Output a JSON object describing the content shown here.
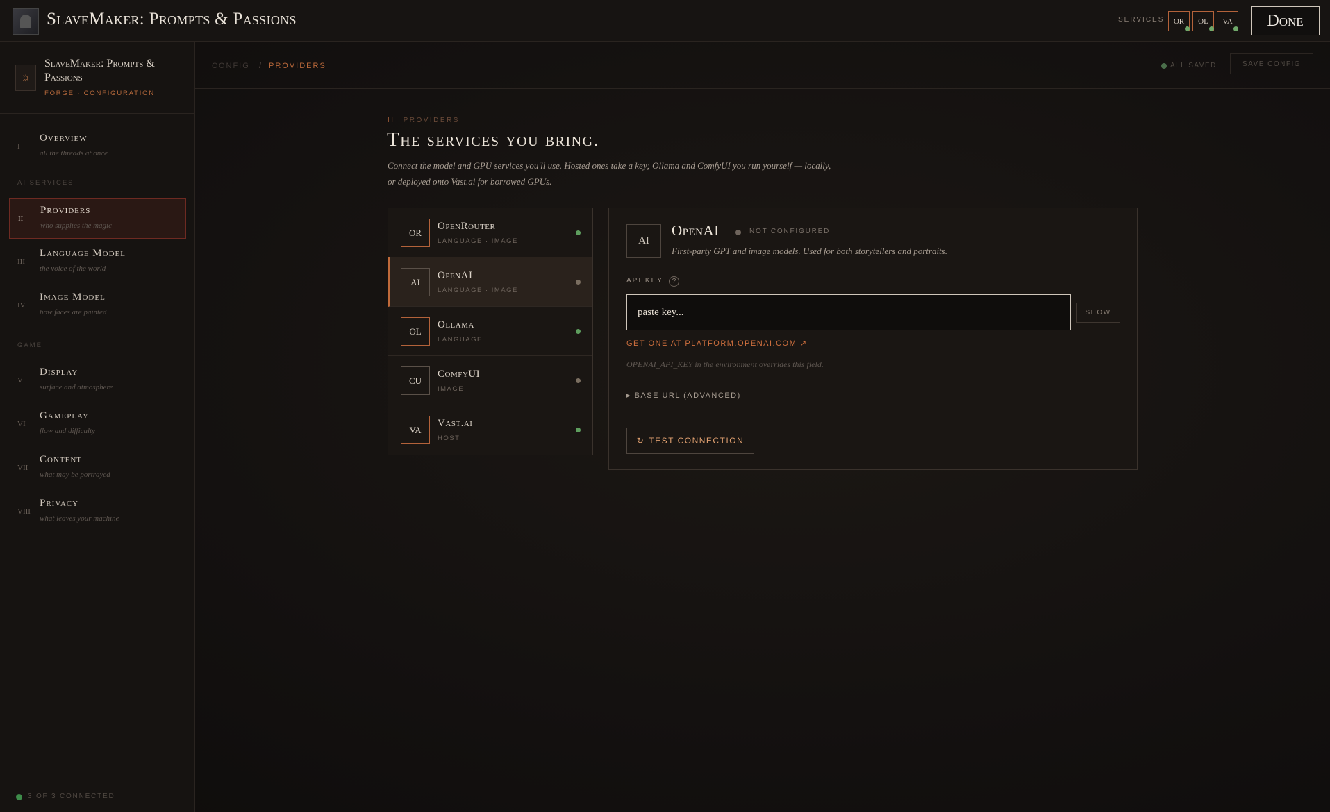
{
  "topbar": {
    "title": "SlaveMaker: Prompts & Passions",
    "services_label": "SERVICES",
    "service_chips": [
      "OR",
      "OL",
      "VA"
    ],
    "done_label": "Done"
  },
  "sidebar": {
    "title": "SlaveMaker: Prompts & Passions",
    "subtitle": "FORGE · CONFIGURATION",
    "sections": {
      "ai": "AI SERVICES",
      "game": "GAME"
    },
    "items": [
      {
        "num": "I",
        "label": "Overview",
        "desc": "all the threads at once"
      },
      {
        "num": "II",
        "label": "Providers",
        "desc": "who supplies the magic"
      },
      {
        "num": "III",
        "label": "Language Model",
        "desc": "the voice of the world"
      },
      {
        "num": "IV",
        "label": "Image Model",
        "desc": "how faces are painted"
      },
      {
        "num": "V",
        "label": "Display",
        "desc": "surface and atmosphere"
      },
      {
        "num": "VI",
        "label": "Gameplay",
        "desc": "flow and difficulty"
      },
      {
        "num": "VII",
        "label": "Content",
        "desc": "what may be portrayed"
      },
      {
        "num": "VIII",
        "label": "Privacy",
        "desc": "what leaves your machine"
      }
    ],
    "footer": "3 OF 3 CONNECTED"
  },
  "breadcrumb": {
    "root": "CONFIG",
    "separator": "/",
    "current": "PROVIDERS",
    "saved_status": "ALL SAVED",
    "save_label": "SAVE CONFIG"
  },
  "main": {
    "eyebrow_num": "II",
    "eyebrow": "PROVIDERS",
    "title": "The services you bring.",
    "description": "Connect the model and GPU services you'll use. Hosted ones take a key; Ollama and ComfyUI you run yourself — locally, or deployed onto Vast.ai for borrowed GPUs."
  },
  "providers": [
    {
      "badge": "OR",
      "name": "OpenRouter",
      "tags": "LANGUAGE · IMAGE",
      "status": "connected"
    },
    {
      "badge": "AI",
      "name": "OpenAI",
      "tags": "LANGUAGE · IMAGE",
      "status": "idle"
    },
    {
      "badge": "OL",
      "name": "Ollama",
      "tags": "LANGUAGE",
      "status": "connected"
    },
    {
      "badge": "CU",
      "name": "ComfyUI",
      "tags": "IMAGE",
      "status": "idle"
    },
    {
      "badge": "VA",
      "name": "Vast.ai",
      "tags": "HOST",
      "status": "connected"
    }
  ],
  "detail": {
    "badge": "AI",
    "name": "OpenAI",
    "status": "NOT CONFIGURED",
    "description": "First-party GPT and image models. Used for both storytellers and portraits.",
    "api_key_label": "API KEY",
    "help_glyph": "?",
    "api_key_placeholder": "paste key...",
    "show_label": "SHOW",
    "get_key_link": "GET ONE AT PLATFORM.OPENAI.COM ↗",
    "env_note": "OPENAI_API_KEY in the environment overrides this field.",
    "advanced_label": "▸ BASE URL (ADVANCED)",
    "test_icon": "↻",
    "test_label": "TEST CONNECTION"
  },
  "colors": {
    "accent": "#c06a3a",
    "connected": "#5e9e5e",
    "active_nav_border": "#6e2a22"
  }
}
